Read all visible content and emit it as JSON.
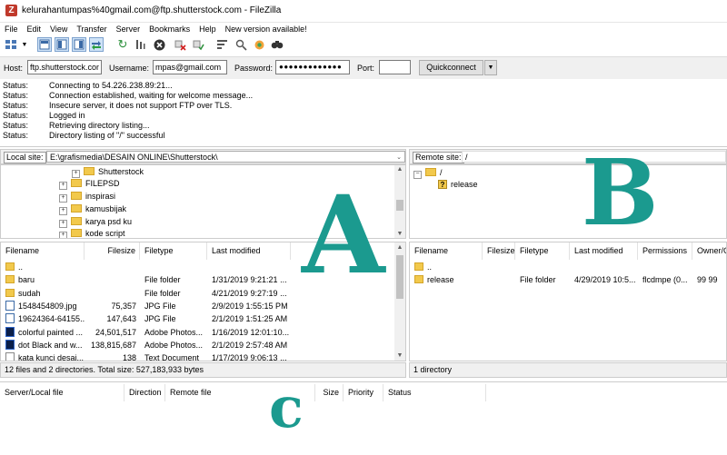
{
  "window": {
    "title": "kelurahantumpas%40gmail.com@ftp.shutterstock.com - FileZilla",
    "app_icon": "filezilla-icon",
    "brand_color": "#c0392b"
  },
  "menu": {
    "items": [
      "File",
      "Edit",
      "View",
      "Transfer",
      "Server",
      "Bookmarks",
      "Help",
      "New version available!"
    ]
  },
  "toolbar": {
    "icons": [
      "site-manager-icon",
      "dropdown-arrow-icon",
      "toggle-message-log-icon",
      "toggle-local-tree-icon",
      "toggle-remote-tree-icon",
      "toggle-transfer-queue-icon",
      "refresh-icon",
      "process-queue-icon",
      "cancel-icon",
      "disconnect-icon",
      "reconnect-icon",
      "directory-filter-icon",
      "toggle-filter-icon",
      "sync-browsing-icon",
      "search-icon"
    ]
  },
  "quickconnect": {
    "host_label": "Host:",
    "host_value": "ftp.shutterstock.com",
    "username_label": "Username:",
    "username_value": "mpas@gmail.com",
    "password_label": "Password:",
    "password_value": "●●●●●●●●●●●●●",
    "port_label": "Port:",
    "port_value": "",
    "button_label": "Quickconnect",
    "dropdown_glyph": "▼"
  },
  "log": [
    {
      "key": "Status:",
      "msg": "Connecting to 54.226.238.89:21..."
    },
    {
      "key": "Status:",
      "msg": "Connection established, waiting for welcome message..."
    },
    {
      "key": "Status:",
      "msg": "Insecure server, it does not support FTP over TLS."
    },
    {
      "key": "Status:",
      "msg": "Logged in"
    },
    {
      "key": "Status:",
      "msg": "Retrieving directory listing..."
    },
    {
      "key": "Status:",
      "msg": "Directory listing of \"/\" successful"
    }
  ],
  "local": {
    "site_label": "Local site:",
    "path": "E:\\grafismedia\\DESAIN ONLINE\\Shutterstock\\",
    "tree": [
      "Shutterstock",
      "FILEPSD",
      "inspirasi",
      "kamusbijak",
      "karya psd ku",
      "kode script"
    ],
    "columns": [
      "Filename",
      "Filesize",
      "Filetype",
      "Last modified"
    ],
    "rows": [
      {
        "name": "..",
        "size": "",
        "type": "",
        "modified": "",
        "icon": "folder"
      },
      {
        "name": "baru",
        "size": "",
        "type": "File folder",
        "modified": "1/31/2019 9:21:21 ...",
        "icon": "folder"
      },
      {
        "name": "sudah",
        "size": "",
        "type": "File folder",
        "modified": "4/21/2019 9:27:19 ...",
        "icon": "folder"
      },
      {
        "name": "1548454809.jpg",
        "size": "75,357",
        "type": "JPG File",
        "modified": "2/9/2019 1:55:15 PM",
        "icon": "jpg"
      },
      {
        "name": "19624364-64155....",
        "size": "147,643",
        "type": "JPG File",
        "modified": "2/1/2019 1:51:25 AM",
        "icon": "jpg"
      },
      {
        "name": "colorful painted ...",
        "size": "24,501,517",
        "type": "Adobe Photos...",
        "modified": "1/16/2019 12:01:10...",
        "icon": "psd"
      },
      {
        "name": "dot Black and w...",
        "size": "138,815,687",
        "type": "Adobe Photos...",
        "modified": "2/1/2019 2:57:48 AM",
        "icon": "psd"
      },
      {
        "name": "kata kunci desai...",
        "size": "138",
        "type": "Text Document",
        "modified": "1/17/2019 9:06:13 ...",
        "icon": "txt"
      }
    ],
    "status": "12 files and 2 directories. Total size: 527,183,933 bytes"
  },
  "remote": {
    "site_label": "Remote site:",
    "path": "/",
    "tree": [
      "/",
      "release"
    ],
    "columns": [
      "Filename",
      "Filesize",
      "Filetype",
      "Last modified",
      "Permissions",
      "Owner/G"
    ],
    "rows": [
      {
        "name": "..",
        "size": "",
        "type": "",
        "modified": "",
        "perms": "",
        "owner": "",
        "icon": "folder"
      },
      {
        "name": "release",
        "size": "",
        "type": "File folder",
        "modified": "4/29/2019 10:5...",
        "perms": "flcdmpe (0...",
        "owner": "99 99",
        "icon": "folder"
      }
    ],
    "status": "1 directory"
  },
  "queue": {
    "columns": [
      "Server/Local file",
      "Direction",
      "Remote file",
      "Size",
      "Priority",
      "Status"
    ]
  },
  "overlay": {
    "a": "A",
    "b": "B",
    "c": "c",
    "color": "#1b9a8f"
  }
}
